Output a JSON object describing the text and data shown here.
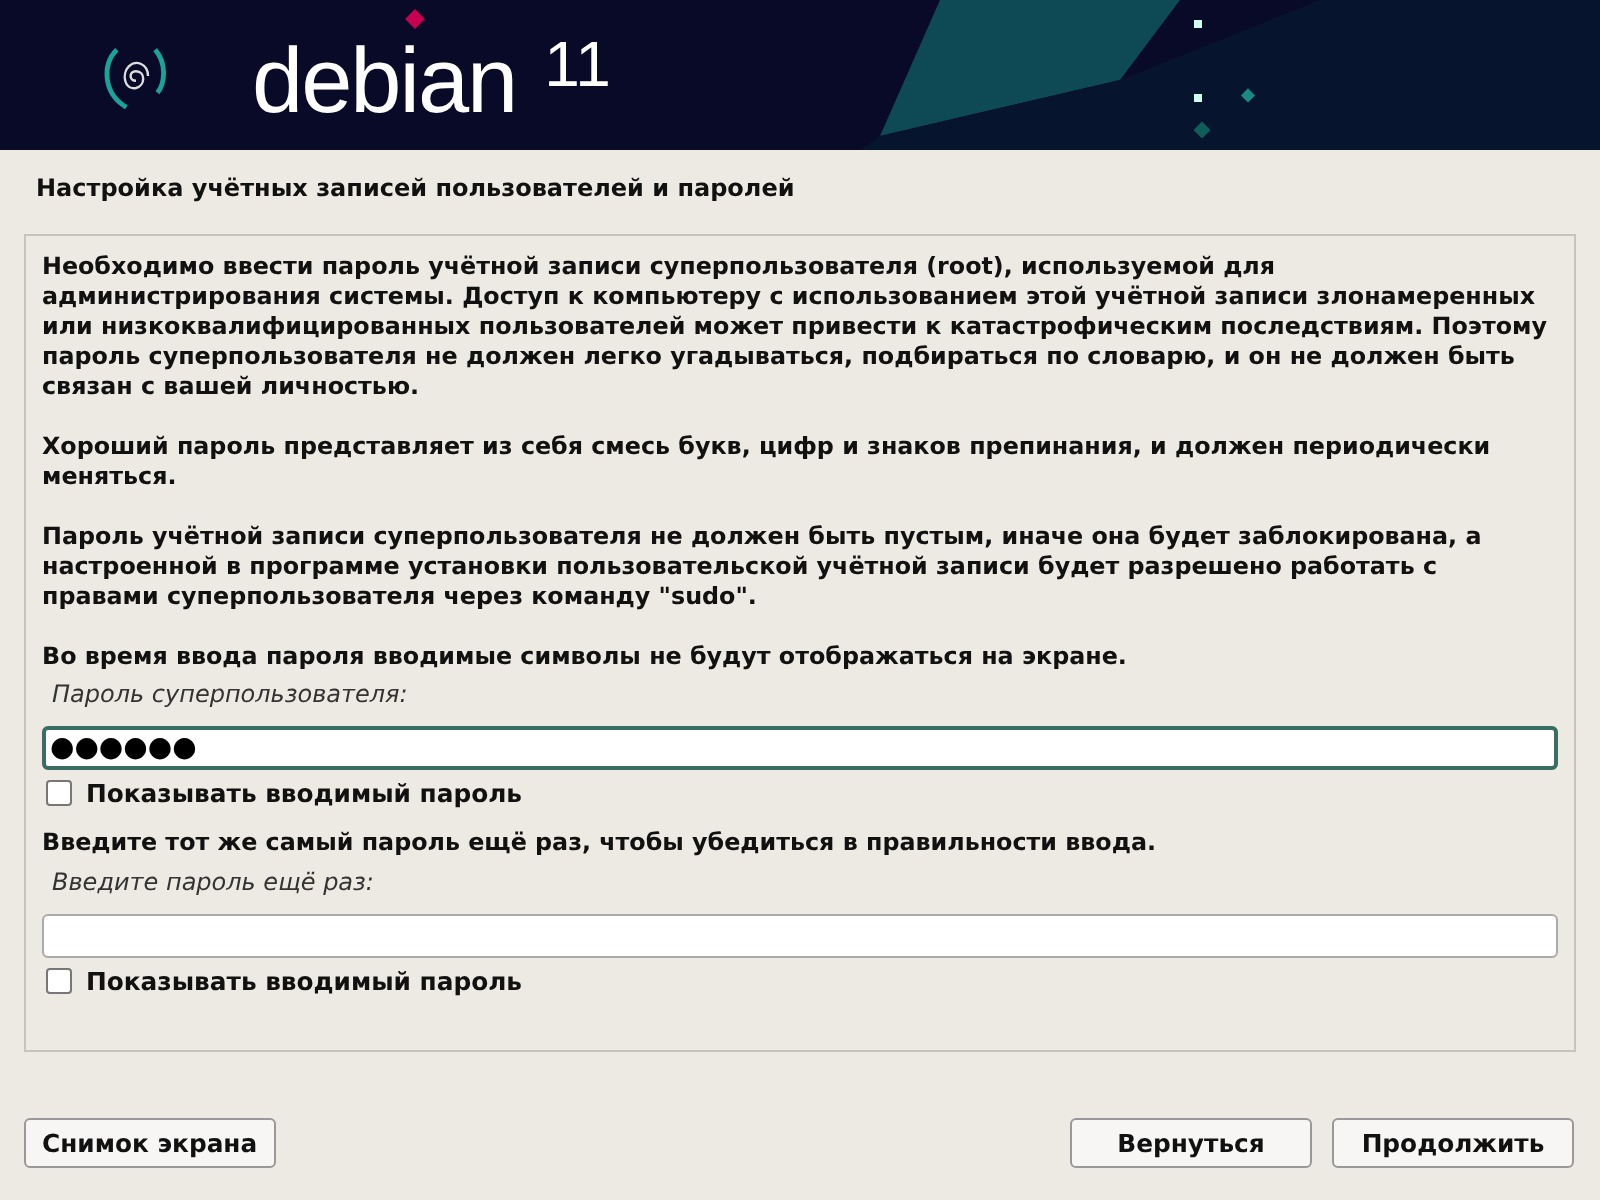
{
  "banner": {
    "brand": "debian",
    "version": "11"
  },
  "title": "Настройка учётных записей пользователей и паролей",
  "paragraphs": [
    "Необходимо ввести пароль учётной записи суперпользователя (root), используемой для администрирования системы. Доступ к компьютеру с использованием этой учётной записи злонамеренных или низкоквалифицированных пользователей может привести к катастрофическим последствиям. Поэтому пароль суперпользователя не должен легко угадываться, подбираться по словарю, и он не должен быть связан с вашей личностью.",
    "Хороший пароль представляет из себя смесь букв, цифр и знаков препинания, и должен периодически меняться.",
    "Пароль учётной записи суперпользователя не должен быть пустым, иначе она будет заблокирована, а настроенной в программе установки пользовательской учётной записи будет разрешено работать с правами суперпользователя через команду \"sudo\".",
    "Во время ввода пароля вводимые символы не будут отображаться на экране."
  ],
  "fields": [
    {
      "label": "Пароль суперпользователя:",
      "value": "●●●●●●",
      "focused": true,
      "show_password": {
        "label": "Показывать вводимый пароль",
        "checked": false
      }
    },
    {
      "prompt": "Введите тот же самый пароль ещё раз, чтобы убедиться в правильности ввода.",
      "label": "Введите пароль ещё раз:",
      "focused": false,
      "show_password": {
        "label": "Показывать вводимый пароль",
        "checked": false
      }
    }
  ],
  "buttons": {
    "left": [
      "Снимок экрана"
    ],
    "right": [
      "Вернуться",
      "Продолжить"
    ]
  }
}
